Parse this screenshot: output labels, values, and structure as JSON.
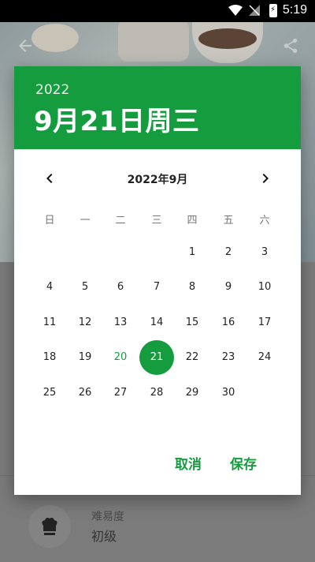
{
  "status_bar": {
    "time": "5:19",
    "icons": [
      "wifi-icon",
      "no-signal-icon",
      "battery-charging-icon"
    ]
  },
  "app_bar": {
    "icons": [
      "back-arrow-icon",
      "share-icon"
    ]
  },
  "recipe": {
    "difficulty_label": "难易度",
    "difficulty_value": "初级",
    "icon": "chef-hat-icon"
  },
  "dialog": {
    "header": {
      "year": "2022",
      "date": "9月21日周三"
    },
    "month_title": "2022年9月",
    "weekdays": [
      "日",
      "一",
      "二",
      "三",
      "四",
      "五",
      "六"
    ],
    "first_weekday_index": 4,
    "days": [
      "1",
      "2",
      "3",
      "4",
      "5",
      "6",
      "7",
      "8",
      "9",
      "10",
      "11",
      "12",
      "13",
      "14",
      "15",
      "16",
      "17",
      "18",
      "19",
      "20",
      "21",
      "22",
      "23",
      "24",
      "25",
      "26",
      "27",
      "28",
      "29",
      "30"
    ],
    "today": "20",
    "selected": "21",
    "cancel_label": "取消",
    "save_label": "保存",
    "accent_color": "#159c3e"
  }
}
